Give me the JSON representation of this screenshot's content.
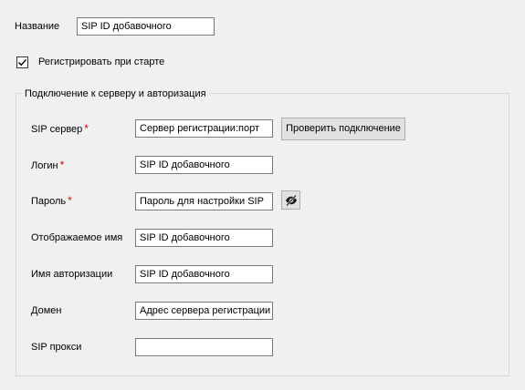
{
  "name": {
    "label": "Название",
    "value": "SIP ID добавочного"
  },
  "register_on_start": {
    "label": "Регистрировать при старте",
    "checked": true
  },
  "connection_group": {
    "title": "Подключение к серверу и авторизация",
    "sip_server": {
      "label": "SIP сервер",
      "required_mark": "*",
      "value": "Сервер регистрации:порт"
    },
    "test_connection_button": "Проверить подключение",
    "login": {
      "label": "Логин",
      "required_mark": "*",
      "value": "SIP ID добавочного"
    },
    "password": {
      "label": "Пароль",
      "required_mark": "*",
      "value": "Пароль для настройки SIP",
      "toggle_icon": "eye-slash-icon"
    },
    "display_name": {
      "label": "Отображаемое имя",
      "value": "SIP ID добавочного"
    },
    "auth_name": {
      "label": "Имя авторизации",
      "value": "SIP ID добавочного"
    },
    "domain": {
      "label": "Домен",
      "value": "Адрес сервера регистрации"
    },
    "sip_proxy": {
      "label": "SIP прокси",
      "value": ""
    }
  },
  "colors": {
    "background": "#f0f0f0",
    "required": "#e00000",
    "border": "#7a7a7a"
  }
}
